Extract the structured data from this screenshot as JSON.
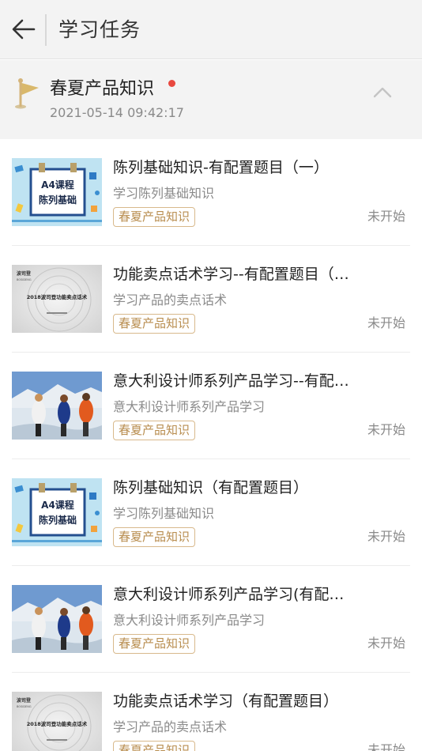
{
  "header": {
    "title": "学习任务",
    "back_icon": "back-arrow-icon"
  },
  "group": {
    "title": "春夏产品知识",
    "timestamp": "2021-05-14 09:42:17",
    "flag_icon": "flag-icon",
    "unread_dot_color": "#e8483f",
    "collapse_icon": "chevron-up-icon"
  },
  "thumb_texts": {
    "a4": {
      "line1": "A4课程",
      "line2": "陈列基础"
    },
    "func": {
      "brand": "波司登",
      "brand_sub": "BOSIDENG",
      "title": "2018波司登功能卖点话术"
    }
  },
  "items": [
    {
      "title": "陈列基础知识-有配置题目（一）",
      "subtitle": "学习陈列基础知识",
      "tag": "春夏产品知识",
      "status": "未开始",
      "thumb": "a4"
    },
    {
      "title": "功能卖点话术学习--有配置题目（一）",
      "subtitle": "学习产品的卖点话术",
      "tag": "春夏产品知识",
      "status": "未开始",
      "thumb": "func"
    },
    {
      "title": "意大利设计师系列产品学习--有配置题目（一）",
      "subtitle": "意大利设计师系列产品学习",
      "tag": "春夏产品知识",
      "status": "未开始",
      "thumb": "photo"
    },
    {
      "title": "陈列基础知识（有配置题目）",
      "subtitle": "学习陈列基础知识",
      "tag": "春夏产品知识",
      "status": "未开始",
      "thumb": "a4"
    },
    {
      "title": "意大利设计师系列产品学习(有配置题目)",
      "subtitle": "意大利设计师系列产品学习",
      "tag": "春夏产品知识",
      "status": "未开始",
      "thumb": "photo"
    },
    {
      "title": "功能卖点话术学习（有配置题目）",
      "subtitle": "学习产品的卖点话术",
      "tag": "春夏产品知识",
      "status": "未开始",
      "thumb": "func"
    }
  ],
  "colors": {
    "accent_tag": "#b88d4f",
    "tag_border": "#d8b98c",
    "header_bg": "#f3f3f3"
  }
}
